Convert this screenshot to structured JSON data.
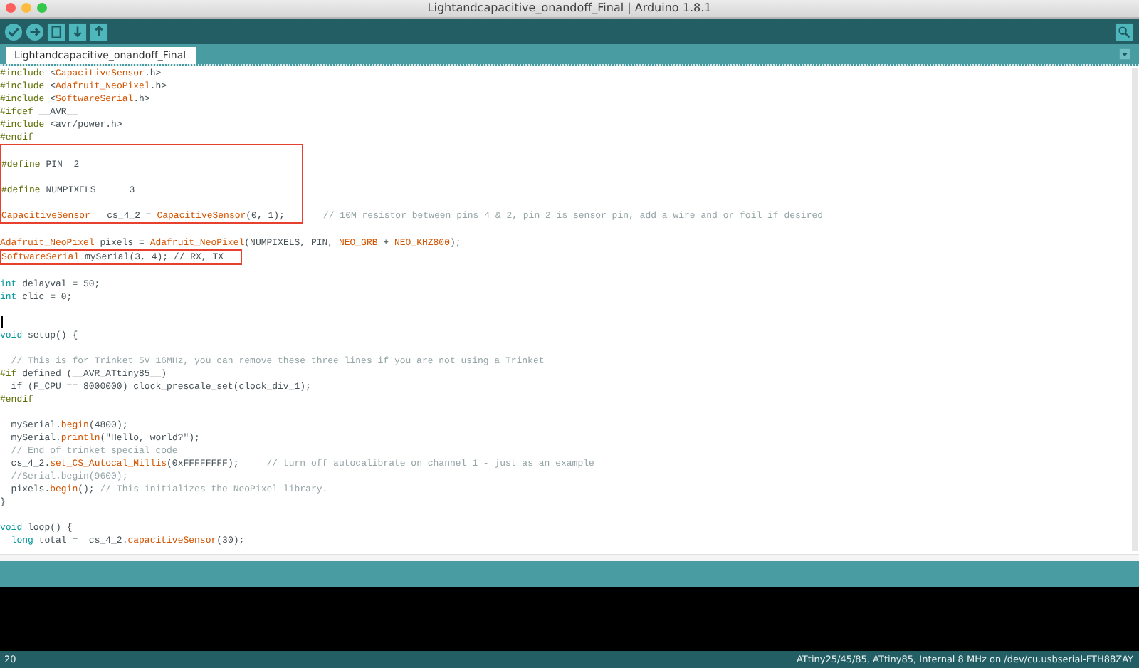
{
  "window": {
    "title": "Lightandcapacitive_onandoff_Final | Arduino 1.8.1"
  },
  "tabs": [
    {
      "label": "Lightandcapacitive_onandoff_Final",
      "selected": true
    }
  ],
  "editor": {
    "lines": [
      {
        "kind": "code",
        "tokens": [
          {
            "kind": "pre",
            "text": "#include"
          },
          {
            "kind": "plain",
            "text": " <"
          },
          {
            "kind": "lib",
            "text": "CapacitiveSensor"
          },
          {
            "kind": "plain",
            "text": ".h>"
          }
        ]
      },
      {
        "kind": "code",
        "tokens": [
          {
            "kind": "pre",
            "text": "#include"
          },
          {
            "kind": "plain",
            "text": " <"
          },
          {
            "kind": "lib",
            "text": "Adafruit_NeoPixel"
          },
          {
            "kind": "plain",
            "text": ".h>"
          }
        ]
      },
      {
        "kind": "code",
        "tokens": [
          {
            "kind": "pre",
            "text": "#include"
          },
          {
            "kind": "plain",
            "text": " <"
          },
          {
            "kind": "lib",
            "text": "SoftwareSerial"
          },
          {
            "kind": "plain",
            "text": ".h>"
          }
        ]
      },
      {
        "kind": "code",
        "tokens": [
          {
            "kind": "pre",
            "text": "#ifdef"
          },
          {
            "kind": "plain",
            "text": " __AVR__"
          }
        ]
      },
      {
        "kind": "code",
        "tokens": [
          {
            "kind": "pre",
            "text": "#include"
          },
          {
            "kind": "plain",
            "text": " <avr/power.h>"
          }
        ]
      },
      {
        "kind": "code",
        "tokens": [
          {
            "kind": "pre",
            "text": "#endif"
          }
        ]
      },
      {
        "kind": "blank",
        "boxed": true
      },
      {
        "kind": "code",
        "boxed": true,
        "tokens": [
          {
            "kind": "pre",
            "text": "#define"
          },
          {
            "kind": "plain",
            "text": " PIN  2"
          }
        ]
      },
      {
        "kind": "blank",
        "boxed": true
      },
      {
        "kind": "code",
        "boxed": true,
        "tokens": [
          {
            "kind": "pre",
            "text": "#define"
          },
          {
            "kind": "plain",
            "text": " NUMPIXELS      3"
          }
        ]
      },
      {
        "kind": "blank",
        "boxed": true
      },
      {
        "kind": "code",
        "boxed": true,
        "tokens": [
          {
            "kind": "lib",
            "text": "CapacitiveSensor"
          },
          {
            "kind": "plain",
            "text": "   cs_4_2 = "
          },
          {
            "kind": "lib",
            "text": "CapacitiveSensor"
          },
          {
            "kind": "plain",
            "text": "(0, 1);"
          }
        ],
        "note": "// 10M resistor between pins 4 & 2, pin 2 is sensor pin, add a wire and or foil if desired"
      },
      {
        "kind": "blank"
      },
      {
        "kind": "code",
        "tokens": [
          {
            "kind": "lib",
            "text": "Adafruit_NeoPixel"
          },
          {
            "kind": "plain",
            "text": " pixels = "
          },
          {
            "kind": "lib",
            "text": "Adafruit_NeoPixel"
          },
          {
            "kind": "plain",
            "text": "(NUMPIXELS, PIN, "
          },
          {
            "kind": "lib",
            "text": "NEO_GRB"
          },
          {
            "kind": "plain",
            "text": " + "
          },
          {
            "kind": "lib",
            "text": "NEO_KHZ800"
          },
          {
            "kind": "plain",
            "text": ");"
          }
        ]
      },
      {
        "kind": "code",
        "boxed": true,
        "tokens": [
          {
            "kind": "lib",
            "text": "SoftwareSerial"
          },
          {
            "kind": "plain",
            "text": " mySerial(3, 4); // RX, TX"
          }
        ]
      },
      {
        "kind": "blank"
      },
      {
        "kind": "code",
        "tokens": [
          {
            "kind": "kw",
            "text": "int"
          },
          {
            "kind": "plain",
            "text": " delayval = 50;"
          }
        ]
      },
      {
        "kind": "code",
        "tokens": [
          {
            "kind": "kw",
            "text": "int"
          },
          {
            "kind": "plain",
            "text": " clic = 0;"
          }
        ]
      },
      {
        "kind": "blank"
      },
      {
        "kind": "cursor"
      },
      {
        "kind": "code",
        "tokens": [
          {
            "kind": "kw",
            "text": "void"
          },
          {
            "kind": "plain",
            "text": " setup() {"
          }
        ]
      },
      {
        "kind": "blank"
      },
      {
        "kind": "code",
        "tokens": [
          {
            "kind": "comment",
            "text": "  // This is for Trinket 5V 16MHz, you can remove these three lines if you are not using a Trinket"
          }
        ]
      },
      {
        "kind": "code",
        "tokens": [
          {
            "kind": "pre",
            "text": "#if"
          },
          {
            "kind": "plain",
            "text": " defined (__AVR_ATtiny85__)"
          }
        ]
      },
      {
        "kind": "code",
        "tokens": [
          {
            "kind": "plain",
            "text": "  if (F_CPU == 8000000) clock_prescale_set(clock_div_1);"
          }
        ]
      },
      {
        "kind": "code",
        "tokens": [
          {
            "kind": "pre",
            "text": "#endif"
          }
        ]
      },
      {
        "kind": "blank"
      },
      {
        "kind": "code",
        "tokens": [
          {
            "kind": "plain",
            "text": "  mySerial."
          },
          {
            "kind": "lib",
            "text": "begin"
          },
          {
            "kind": "plain",
            "text": "(4800);"
          }
        ]
      },
      {
        "kind": "code",
        "tokens": [
          {
            "kind": "plain",
            "text": "  mySerial."
          },
          {
            "kind": "lib",
            "text": "println"
          },
          {
            "kind": "plain",
            "text": "(\"Hello, world?\");"
          }
        ]
      },
      {
        "kind": "code",
        "tokens": [
          {
            "kind": "comment",
            "text": "  // End of trinket special code"
          }
        ]
      },
      {
        "kind": "code",
        "tokens": [
          {
            "kind": "plain",
            "text": "  cs_4_2."
          },
          {
            "kind": "lib",
            "text": "set_CS_Autocal_Millis"
          },
          {
            "kind": "plain",
            "text": "(0xFFFFFFFF);"
          },
          {
            "kind": "comment",
            "text": "     // turn off autocalibrate on channel 1 - just as an example"
          }
        ]
      },
      {
        "kind": "code",
        "tokens": [
          {
            "kind": "comment",
            "text": "  //Serial.begin(9600);"
          }
        ]
      },
      {
        "kind": "code",
        "tokens": [
          {
            "kind": "plain",
            "text": "  pixels."
          },
          {
            "kind": "lib",
            "text": "begin"
          },
          {
            "kind": "plain",
            "text": "(); "
          },
          {
            "kind": "comment",
            "text": "// This initializes the NeoPixel library."
          }
        ]
      },
      {
        "kind": "code",
        "tokens": [
          {
            "kind": "plain",
            "text": "}"
          }
        ]
      },
      {
        "kind": "blank"
      },
      {
        "kind": "code",
        "tokens": [
          {
            "kind": "kw",
            "text": "void"
          },
          {
            "kind": "plain",
            "text": " loop() {"
          }
        ]
      },
      {
        "kind": "code",
        "tokens": [
          {
            "kind": "kw",
            "text": "  long"
          },
          {
            "kind": "plain",
            "text": " total =  cs_4_2."
          },
          {
            "kind": "lib",
            "text": "capacitiveSensor"
          },
          {
            "kind": "plain",
            "text": "(30);"
          }
        ]
      }
    ]
  },
  "status_bar": {
    "line_number": "20",
    "board": "ATtiny25/45/85, ATtiny85, Internal 8 MHz on /dev/cu.usbserial-FTH88ZAY"
  }
}
